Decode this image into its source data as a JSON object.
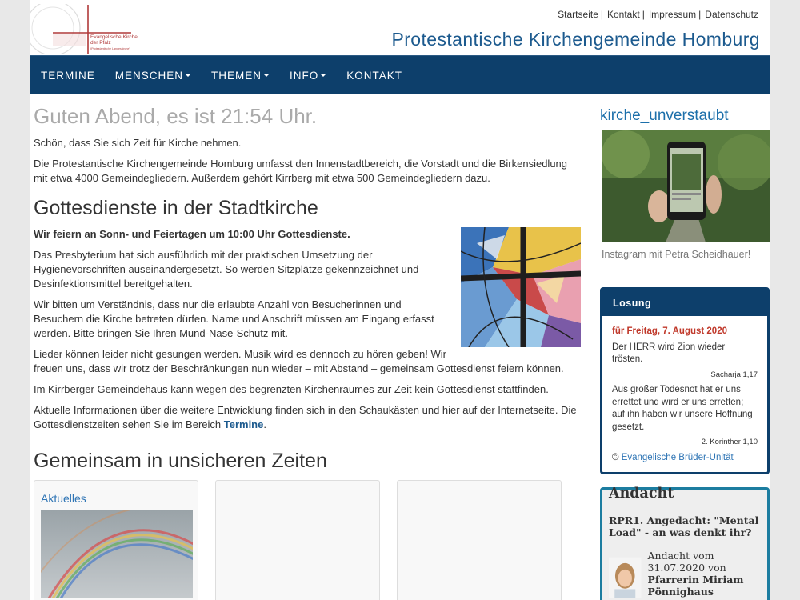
{
  "logo": {
    "text1": "Evangelische Kirche",
    "text2": "der Pfalz",
    "text3": "(Protestantische Landeskirche)"
  },
  "toplinks": [
    "Startseite",
    "Kontakt",
    "Impressum",
    "Datenschutz"
  ],
  "site_title": "Protestantische Kirchengemeinde Homburg",
  "nav": {
    "items": [
      {
        "label": "TERMINE",
        "dropdown": false
      },
      {
        "label": "MENSCHEN",
        "dropdown": true
      },
      {
        "label": "THEMEN",
        "dropdown": true
      },
      {
        "label": "INFO",
        "dropdown": true
      },
      {
        "label": "KONTAKT",
        "dropdown": false
      }
    ]
  },
  "main": {
    "greeting": "Guten Abend, es ist 21:54 Uhr.",
    "intro1": "Schön, dass Sie sich Zeit für Kirche nehmen.",
    "intro2": "Die Protestantische Kirchengemeinde Homburg umfasst den Innenstadtbereich, die Vorstadt und die Birkensiedlung mit etwa 4000 Gemeindegliedern. Außerdem gehört Kirrberg mit etwa 500 Gemeindegliedern dazu.",
    "section1_title": "Gottesdienste in der Stadtkirche",
    "s1_bold": "Wir feiern an Sonn- und Feiertagen um 10:00 Uhr Gottesdienste.",
    "s1_p1": "Das Presbyterium hat sich ausführlich mit der praktischen Umsetzung der Hygienevorschriften auseinandergesetzt. So werden Sitzplätze gekennzeichnet und Desinfektionsmittel bereitgehalten.",
    "s1_p2": "Wir bitten um Verständnis, dass nur die erlaubte Anzahl von Besucherinnen und Besuchern die Kirche betreten dürfen. Name und Anschrift müssen am Eingang erfasst werden. Bitte bringen Sie Ihren Mund-Nase-Schutz mit.",
    "s1_p3": "Lieder können leider nicht gesungen werden. Musik wird es dennoch zu hören geben! Wir freuen uns, dass wir trotz der Beschränkungen nun wieder – mit Abstand – gemeinsam Gottesdienst feiern können.",
    "s1_p4": "Im Kirrberger Gemeindehaus kann wegen des begrenzten Kirchenraumes zur Zeit kein Gottesdienst stattfinden.",
    "s1_p5_pre": "Aktuelle Informationen über die weitere Entwicklung finden sich in den Schaukästen und hier auf der Internetseite. Die Gottesdienstzeiten sehen Sie im Bereich ",
    "s1_p5_link": "Termine",
    "s1_p5_post": ".",
    "section2_title": "Gemeinsam in unsicheren Zeiten",
    "card1_title": "Aktuelles"
  },
  "sidebar": {
    "insta_title": "kirche_unverstaubt",
    "insta_caption": "Instagram mit Petra Scheidhauer!",
    "losung": {
      "header": "Losung",
      "date": "für Freitag, 7. August 2020",
      "text1": "Der HERR wird Zion wieder trösten.",
      "ref1": "Sacharja 1,17",
      "text2": "Aus großer Todesnot hat er uns errettet und wird er uns erretten; auf ihn haben wir unsere Hoffnung gesetzt.",
      "ref2": "2. Korinther 1,10",
      "copyright_symbol": "©",
      "copyright_link": "Evangelische Brüder-Unität"
    },
    "andacht": {
      "header": "Andacht",
      "subtitle": "RPR1. Angedacht: \"Mental Load\" - an was denkt ihr?",
      "meta_line1": "Andacht vom 31.07.2020 von",
      "meta_author": "Pfarrerin Miriam Pönnighaus"
    }
  },
  "colors": {
    "nav_bg": "#0d3f6b",
    "title_blue": "#1c5a8e",
    "link_blue": "#2f75b5",
    "losung_date_red": "#c0392b",
    "andacht_border": "#1c7da0"
  }
}
